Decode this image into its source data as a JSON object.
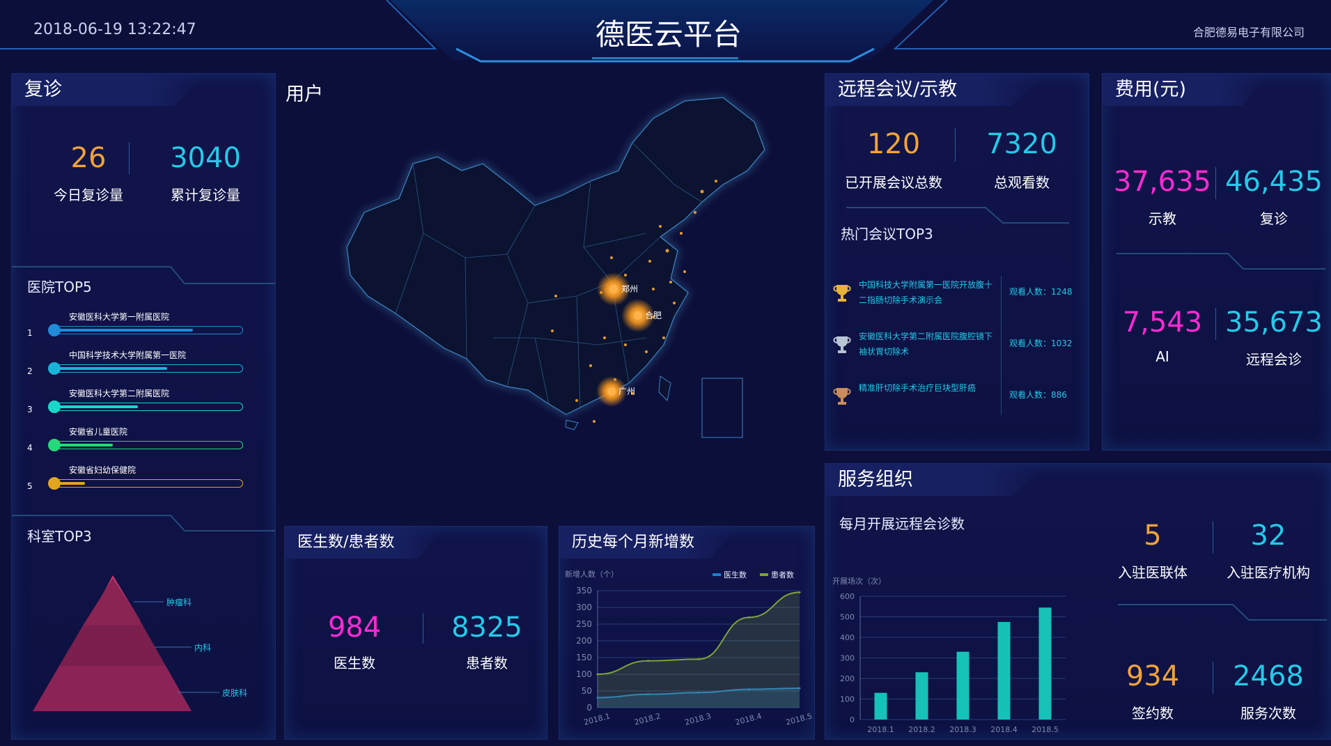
{
  "header": {
    "datetime": "2018-06-19 13:22:47",
    "title": "德医云平台",
    "company": "合肥德易电子有限公司"
  },
  "followup": {
    "title": "复诊",
    "today": "26",
    "today_label": "今日复诊量",
    "total": "3040",
    "total_label": "累计复诊量"
  },
  "hospital_top5": {
    "title": "医院TOP5",
    "items": [
      {
        "rank": "1",
        "name": "安徽医科大学第一附属医院",
        "value": 0.74,
        "color": "#1f8bd9"
      },
      {
        "rank": "2",
        "name": "中国科学技术大学附属第一医院",
        "value": 0.6,
        "color": "#18b5d8"
      },
      {
        "rank": "3",
        "name": "安徽医科大学第二附属医院",
        "value": 0.44,
        "color": "#19d8c9"
      },
      {
        "rank": "4",
        "name": "安徽省儿童医院",
        "value": 0.3,
        "color": "#27d87a"
      },
      {
        "rank": "5",
        "name": "安徽省妇幼保健院",
        "value": 0.15,
        "color": "#e3a51d"
      }
    ]
  },
  "dept_top3": {
    "title": "科室TOP3",
    "items": [
      "肿瘤科",
      "内科",
      "皮肤科"
    ]
  },
  "users": {
    "title": "用户",
    "cities": [
      "郑州",
      "合肥",
      "广州"
    ]
  },
  "doctors_patients": {
    "title": "医生数/患者数",
    "doctors": "984",
    "doctors_label": "医生数",
    "patients": "8325",
    "patients_label": "患者数"
  },
  "monthly_new": {
    "title": "历史每个月新增数"
  },
  "meetings": {
    "title": "远程会议/示教",
    "total": "120",
    "total_label": "已开展会议总数",
    "views": "7320",
    "views_label": "总观看数",
    "hot_title": "热门会议TOP3",
    "hot": [
      {
        "name": "中国科技大学附属第一医院开放腹十二指肠切除手术演示会",
        "views": "观看人数：1248",
        "trophy": "#e8b23c"
      },
      {
        "name": "安徽医科大学第二附属医院腹腔镜下袖状胃切除术",
        "views": "观看人数：1032",
        "trophy": "#b9c4d4"
      },
      {
        "name": "精准肝切除手术治疗巨块型肝癌",
        "views": "观看人数：886",
        "trophy": "#c98d5b"
      }
    ]
  },
  "costs": {
    "title": "费用(元)",
    "items": [
      {
        "value": "37,635",
        "label": "示教"
      },
      {
        "value": "46,435",
        "label": "复诊"
      },
      {
        "value": "7,543",
        "label": "AI"
      },
      {
        "value": "35,673",
        "label": "远程会诊"
      }
    ]
  },
  "service": {
    "title": "服务组织",
    "chart_title": "每月开展远程会诊数",
    "alliances": "5",
    "alliances_label": "入驻医联体",
    "institutions": "32",
    "institutions_label": "入驻医疗机构",
    "contracts": "934",
    "contracts_label": "签约数",
    "services": "2468",
    "services_label": "服务次数"
  },
  "chart_data": [
    {
      "type": "line",
      "ylabel": "新增人数（个）",
      "x": [
        "2018.1",
        "2018.2",
        "2018.3",
        "2018.4",
        "2018.5"
      ],
      "ylim": [
        0,
        350
      ],
      "yticks": [
        0,
        50,
        100,
        150,
        200,
        250,
        300,
        350
      ],
      "series": [
        {
          "name": "医生数",
          "color": "#1f7fd6",
          "values": [
            30,
            40,
            45,
            55,
            58
          ]
        },
        {
          "name": "患者数",
          "color": "#7fa33a",
          "values": [
            100,
            140,
            145,
            270,
            345
          ]
        }
      ]
    },
    {
      "type": "bar",
      "ylabel": "开展场次（次）",
      "categories": [
        "2018.1",
        "2018.2",
        "2018.3",
        "2018.4",
        "2018.5"
      ],
      "values": [
        130,
        230,
        330,
        475,
        545
      ],
      "ylim": [
        0,
        600
      ],
      "yticks": [
        0,
        100,
        200,
        300,
        400,
        500,
        600
      ],
      "color": "#16c2b8"
    }
  ]
}
